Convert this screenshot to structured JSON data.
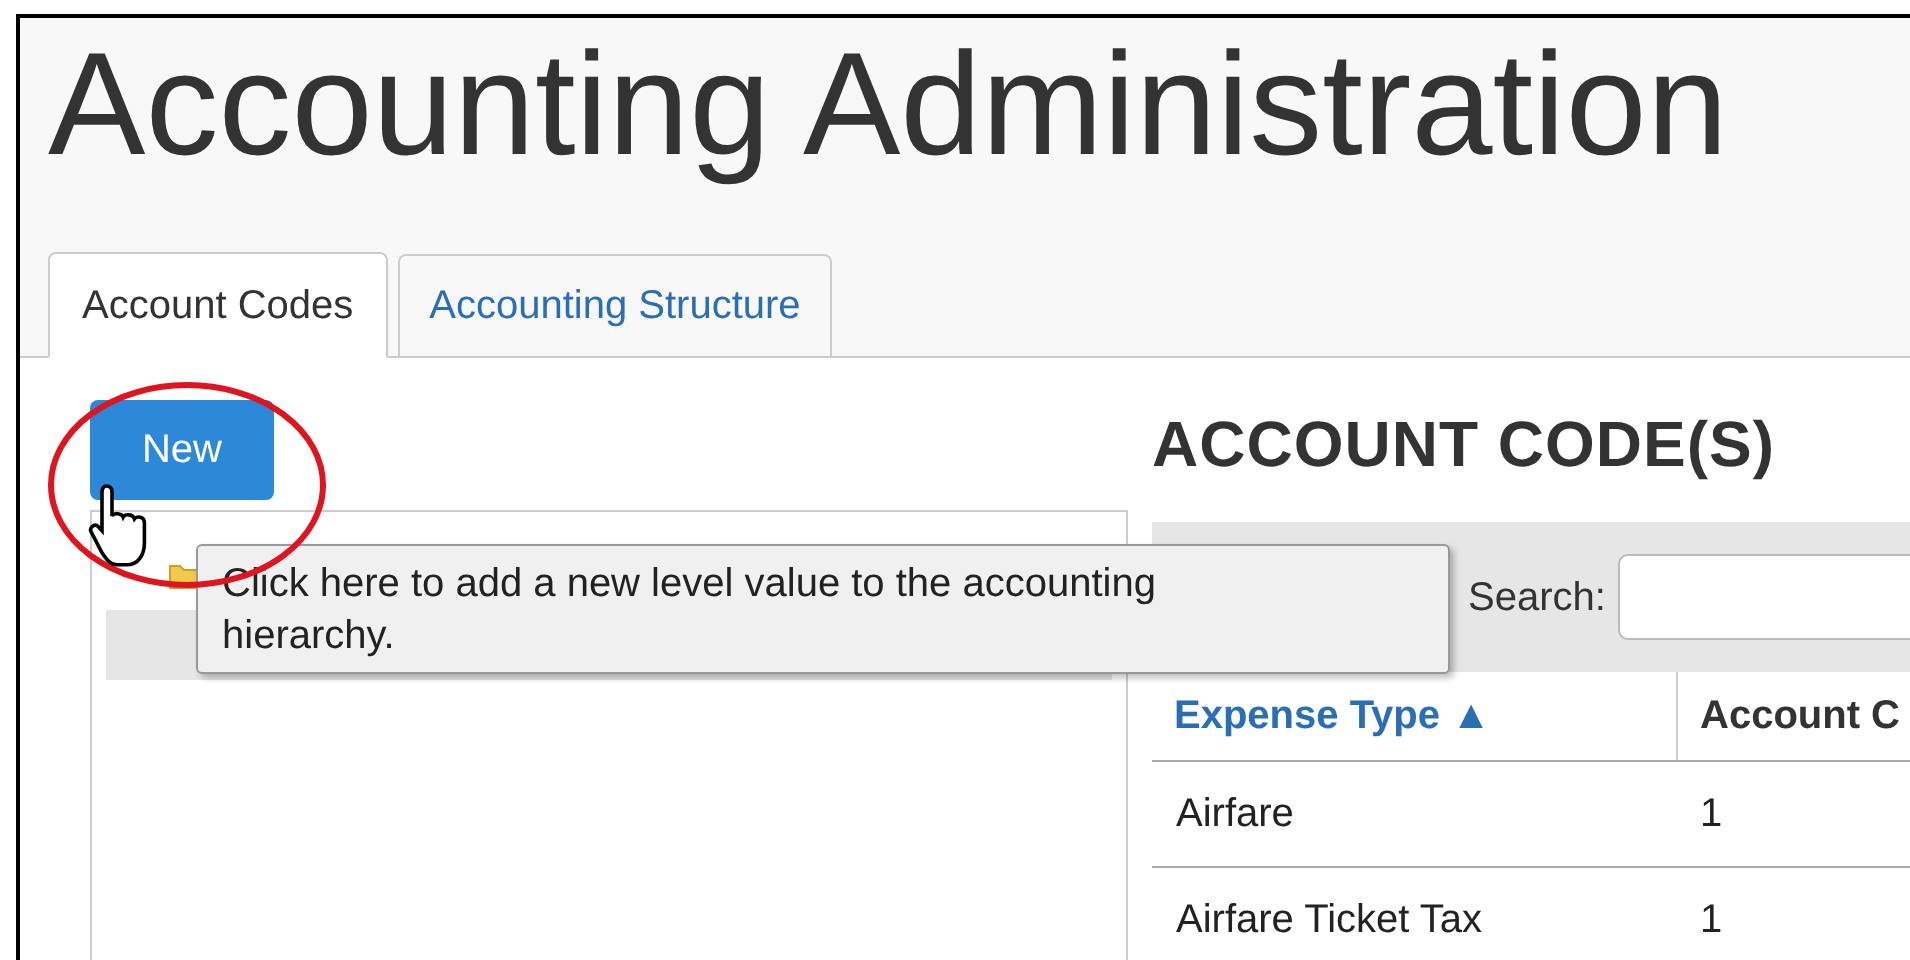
{
  "page_title": "Accounting Administration",
  "tabs": [
    {
      "label": "Account Codes",
      "selected": true
    },
    {
      "label": "Accounting Structure",
      "selected": false
    }
  ],
  "new_button": "New",
  "tooltip": "Click here to add a new level value to the accounting hierarchy.",
  "section_heading": "ACCOUNT CODE(S)",
  "search": {
    "label": "Search:"
  },
  "table": {
    "columns": [
      {
        "label": "Expense Type ▲",
        "sortable": true
      },
      {
        "label": "Account C",
        "sortable": false
      }
    ],
    "rows": [
      [
        "Airfare",
        "1"
      ],
      [
        "Airfare Ticket Tax",
        "1"
      ]
    ]
  }
}
